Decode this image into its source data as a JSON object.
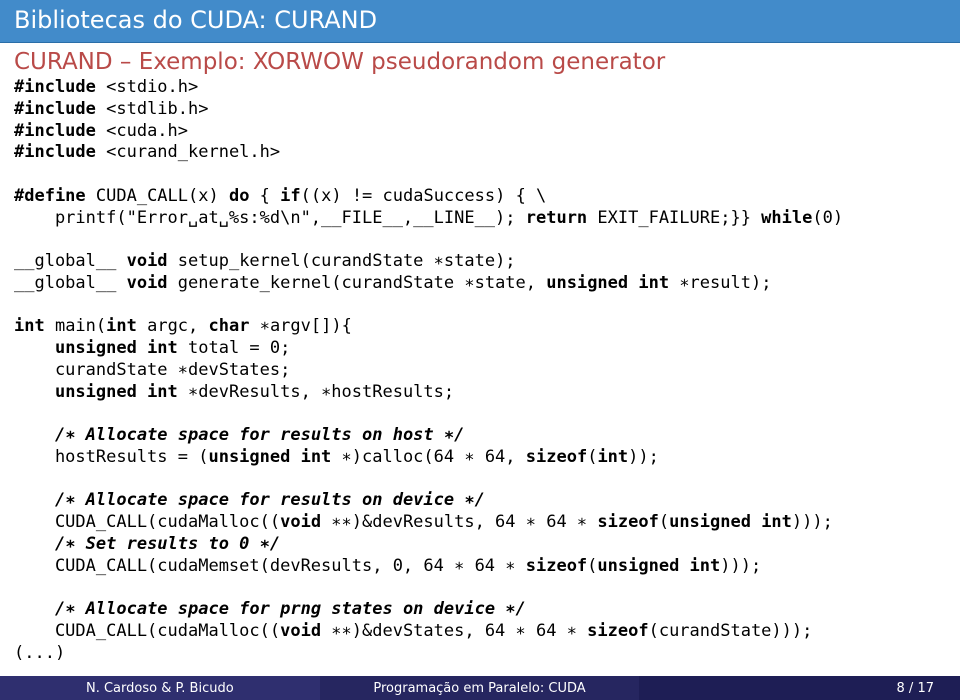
{
  "slide": {
    "title": "Bibliotecas do CUDA: CURAND",
    "subtitle": "CURAND – Exemplo: XORWOW pseudorandom generator"
  },
  "code": {
    "l01a": "#include",
    "l01b": " <stdio.h>",
    "l02a": "#include",
    "l02b": " <stdlib.h>",
    "l03a": "#include",
    "l03b": " <cuda.h>",
    "l04a": "#include",
    "l04b": " <curand_kernel.h>",
    "blank1": "",
    "l05a": "#define",
    "l05b": " CUDA_CALL(x) ",
    "l05c": "do",
    "l05d": " { ",
    "l05e": "if",
    "l05f": "((x) != cudaSuccess) { \\",
    "l06a": "    printf(\"Error␣at␣%s:%d\\n\",__FILE__,__LINE__); ",
    "l06b": "return",
    "l06c": " EXIT_FAILURE;}} ",
    "l06d": "while",
    "l06e": "(0)",
    "blank2": "",
    "l07a": "__global__ ",
    "l07b": "void",
    "l07c": " setup_kernel(curandState ∗state);",
    "l08a": "__global__ ",
    "l08b": "void",
    "l08c": " generate_kernel(curandState ∗state, ",
    "l08d": "unsigned int",
    "l08e": " ∗result);",
    "blank3": "",
    "l09a": "int",
    "l09b": " main(",
    "l09c": "int",
    "l09d": " argc, ",
    "l09e": "char",
    "l09f": " ∗argv[]){",
    "l10a": "    ",
    "l10b": "unsigned int",
    "l10c": " total = 0;",
    "l11": "    curandState ∗devStates;",
    "l12a": "    ",
    "l12b": "unsigned int",
    "l12c": " ∗devResults, ∗hostResults;",
    "blank4": "",
    "l13a": "    ",
    "l13b": "/∗ Allocate space for results on host ∗/",
    "l14a": "    hostResults = (",
    "l14b": "unsigned int",
    "l14c": " ∗)calloc(64 ∗ 64, ",
    "l14d": "sizeof",
    "l14e": "(",
    "l14f": "int",
    "l14g": "));",
    "blank5": "",
    "l15a": "    ",
    "l15b": "/∗ Allocate space for results on device ∗/",
    "l16a": "    CUDA_CALL(cudaMalloc((",
    "l16b": "void",
    "l16c": " ∗∗)&devResults, 64 ∗ 64 ∗ ",
    "l16d": "sizeof",
    "l16e": "(",
    "l16f": "unsigned int",
    "l16g": ")));",
    "l17a": "    ",
    "l17b": "/∗ Set results to 0 ∗/",
    "l18a": "    CUDA_CALL(cudaMemset(devResults, 0, 64 ∗ 64 ∗ ",
    "l18b": "sizeof",
    "l18c": "(",
    "l18d": "unsigned int",
    "l18e": ")));",
    "blank6": "",
    "l19a": "    ",
    "l19b": "/∗ Allocate space for prng states on device ∗/",
    "l20a": "    CUDA_CALL(cudaMalloc((",
    "l20b": "void",
    "l20c": " ∗∗)&devStates, 64 ∗ 64 ∗ ",
    "l20d": "sizeof",
    "l20e": "(curandState)));",
    "l21": "(...)"
  },
  "footer": {
    "left": "N. Cardoso & P. Bicudo",
    "mid": "Programação em Paralelo: CUDA",
    "right": "8 / 17"
  }
}
